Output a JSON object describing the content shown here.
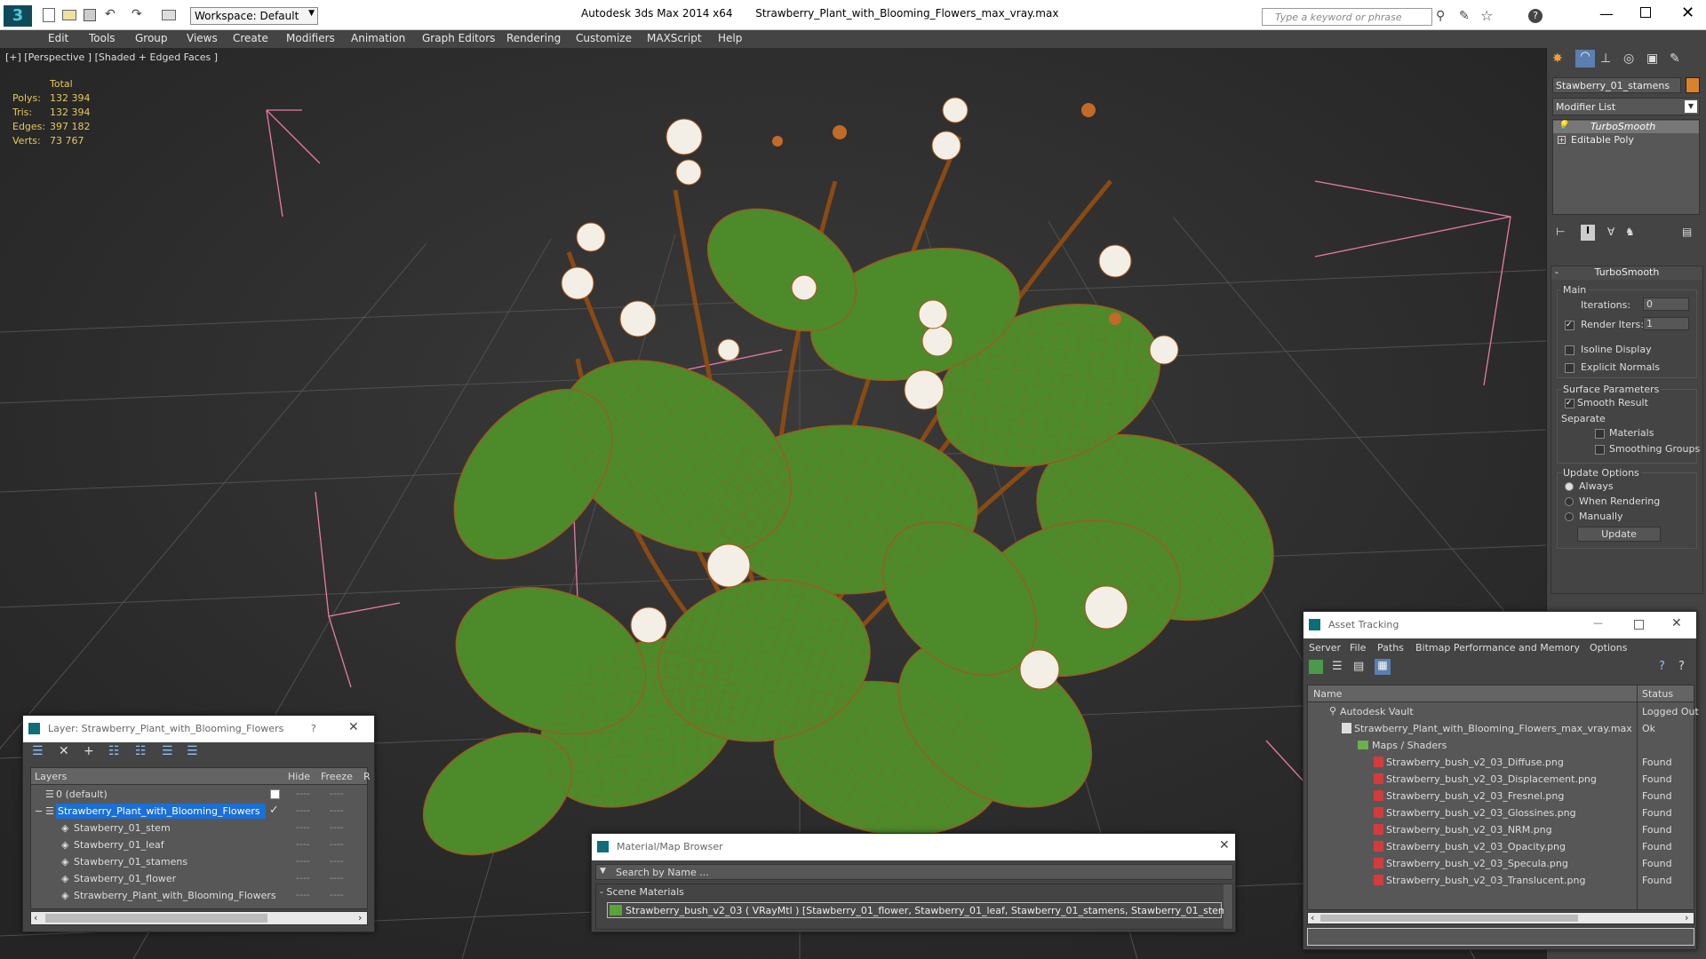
{
  "app": {
    "title": "Autodesk 3ds Max  2014 x64",
    "file": "Strawberry_Plant_with_Blooming_Flowers_max_vray.max",
    "workspace": "Workspace: Default",
    "search_placeholder": "Type a keyword or phrase"
  },
  "menu": [
    "Edit",
    "Tools",
    "Group",
    "Views",
    "Create",
    "Modifiers",
    "Animation",
    "Graph Editors",
    "Rendering",
    "Customize",
    "MAXScript",
    "Help"
  ],
  "viewport": {
    "label": "[+] [Perspective ] [Shaded + Edged Faces ]",
    "stats_header": "Total",
    "stats": [
      {
        "name": "Polys:",
        "value": "132 394"
      },
      {
        "name": "Tris:",
        "value": "132 394"
      },
      {
        "name": "Edges:",
        "value": "397 182"
      },
      {
        "name": "Verts:",
        "value": "73 767"
      }
    ]
  },
  "command_panel": {
    "object_name": "Stawberry_01_stamens",
    "object_color": "#d9822b",
    "modifier_list": "Modifier List",
    "stack": [
      "TurboSmooth",
      "Editable Poly"
    ],
    "rollout_title": "TurboSmooth",
    "main_label": "Main",
    "iterations_label": "Iterations:",
    "iterations_value": "0",
    "render_iters_label": "Render Iters:",
    "render_iters_value": "1",
    "isoline": "Isoline Display",
    "explicit_normals": "Explicit Normals",
    "surface_params": "Surface Parameters",
    "smooth_result": "Smooth Result",
    "separate": "Separate",
    "materials": "Materials",
    "smoothing_groups": "Smoothing Groups",
    "update_options": "Update Options",
    "always": "Always",
    "when_rendering": "When Rendering",
    "manually": "Manually",
    "update_btn": "Update"
  },
  "layers": {
    "title": "Layer: Strawberry_Plant_with_Blooming_Flowers",
    "help": "?",
    "col_layers": "Layers",
    "col_hide": "Hide",
    "col_freeze": "Freeze",
    "col_extra": "R",
    "rows": [
      {
        "name": "0 (default)",
        "indent": 1
      },
      {
        "name": "Strawberry_Plant_with_Blooming_Flowers",
        "indent": 1,
        "selected": true
      },
      {
        "name": "Stawberry_01_stem",
        "indent": 2
      },
      {
        "name": "Stawberry_01_leaf",
        "indent": 2
      },
      {
        "name": "Stawberry_01_stamens",
        "indent": 2
      },
      {
        "name": "Stawberry_01_flower",
        "indent": 2
      },
      {
        "name": "Strawberry_Plant_with_Blooming_Flowers",
        "indent": 2
      }
    ]
  },
  "material_browser": {
    "title": "Material/Map Browser",
    "search": "Search by Name ...",
    "group": "- Scene Materials",
    "item": "Strawberry_bush_v2_03  ( VRayMtl ) [Stawberry_01_flower, Stawberry_01_leaf, Stawberry_01_stamens, Stawberry_01_stem]"
  },
  "asset_tracking": {
    "title": "Asset Tracking",
    "menu": [
      "Server",
      "File",
      "Paths",
      "Bitmap Performance and Memory",
      "Options"
    ],
    "col_name": "Name",
    "col_status": "Status",
    "rows": [
      {
        "name": "Autodesk Vault",
        "status": "Logged Out",
        "indent": 1
      },
      {
        "name": "Strawberry_Plant_with_Blooming_Flowers_max_vray.max",
        "status": "Ok",
        "indent": 2
      },
      {
        "name": "Maps / Shaders",
        "status": "",
        "indent": 3
      },
      {
        "name": "Strawberry_bush_v2_03_Diffuse.png",
        "status": "Found",
        "indent": 4
      },
      {
        "name": "Strawberry_bush_v2_03_Displacement.png",
        "status": "Found",
        "indent": 4
      },
      {
        "name": "Strawberry_bush_v2_03_Fresnel.png",
        "status": "Found",
        "indent": 4
      },
      {
        "name": "Strawberry_bush_v2_03_Glossines.png",
        "status": "Found",
        "indent": 4
      },
      {
        "name": "Strawberry_bush_v2_03_NRM.png",
        "status": "Found",
        "indent": 4
      },
      {
        "name": "Strawberry_bush_v2_03_Opacity.png",
        "status": "Found",
        "indent": 4
      },
      {
        "name": "Strawberry_bush_v2_03_Specula.png",
        "status": "Found",
        "indent": 4
      },
      {
        "name": "Strawberry_bush_v2_03_Translucent.png",
        "status": "Found",
        "indent": 4
      }
    ]
  }
}
